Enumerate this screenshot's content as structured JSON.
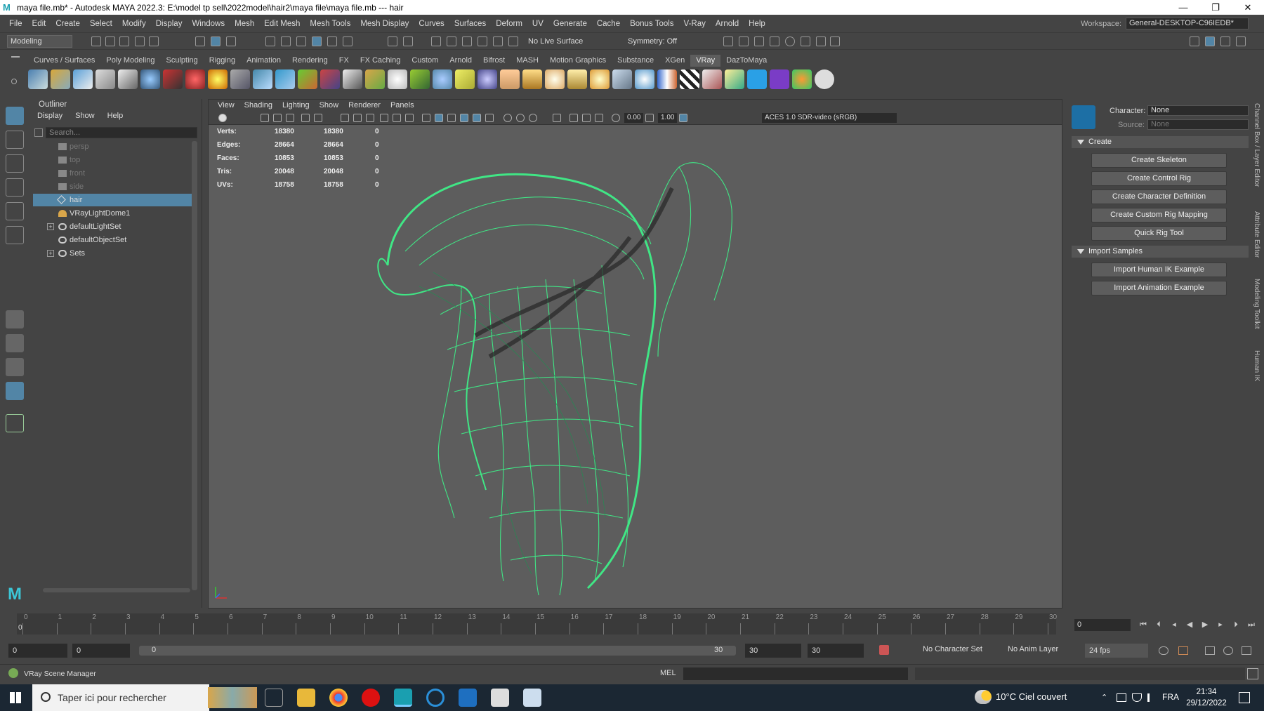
{
  "window": {
    "title": "maya file.mb* - Autodesk MAYA 2022.3: E:\\model tp sell\\2022model\\hair2\\maya file\\maya file.mb  ---  hair",
    "min": "—",
    "max": "❐",
    "close": "✕"
  },
  "menubar": {
    "items": [
      "File",
      "Edit",
      "Create",
      "Select",
      "Modify",
      "Display",
      "Windows",
      "Mesh",
      "Edit Mesh",
      "Mesh Tools",
      "Mesh Display",
      "Curves",
      "Surfaces",
      "Deform",
      "UV",
      "Generate",
      "Cache",
      "Bonus Tools",
      "V-Ray",
      "Arnold",
      "Help"
    ],
    "workspace_label": "Workspace:",
    "workspace_value": "General-DESKTOP-C96IEDB*"
  },
  "statusline": {
    "mode": "Modeling",
    "live_surface": "No Live Surface",
    "symmetry": "Symmetry: Off"
  },
  "shelf": {
    "tabs": [
      "Curves / Surfaces",
      "Poly Modeling",
      "Sculpting",
      "Rigging",
      "Animation",
      "Rendering",
      "FX",
      "FX Caching",
      "Custom",
      "Arnold",
      "Bifrost",
      "MASH",
      "Motion Graphics",
      "Substance",
      "XGen",
      "VRay",
      "DazToMaya"
    ],
    "active": "VRay"
  },
  "outliner": {
    "title": "Outliner",
    "menu": [
      "Display",
      "Show",
      "Help"
    ],
    "search_placeholder": "Search...",
    "items": [
      {
        "label": "persp"
      },
      {
        "label": "top"
      },
      {
        "label": "front"
      },
      {
        "label": "side"
      },
      {
        "label": "hair"
      },
      {
        "label": "VRayLightDome1"
      },
      {
        "label": "defaultLightSet"
      },
      {
        "label": "defaultObjectSet"
      },
      {
        "label": "Sets"
      }
    ]
  },
  "viewport": {
    "menu": [
      "View",
      "Shading",
      "Lighting",
      "Show",
      "Renderer",
      "Panels"
    ],
    "exposure": "0.00",
    "gamma": "1.00",
    "color_space": "ACES 1.0 SDR-video (sRGB)",
    "hud": [
      {
        "label": "Verts:",
        "a": "18380",
        "b": "18380",
        "c": "0"
      },
      {
        "label": "Edges:",
        "a": "28664",
        "b": "28664",
        "c": "0"
      },
      {
        "label": "Faces:",
        "a": "10853",
        "b": "10853",
        "c": "0"
      },
      {
        "label": "Tris:",
        "a": "20048",
        "b": "20048",
        "c": "0"
      },
      {
        "label": "UVs:",
        "a": "18758",
        "b": "18758",
        "c": "0"
      }
    ],
    "wire_color": "#3df58a"
  },
  "humanik": {
    "character_label": "Character:",
    "character_value": "None",
    "source_label": "Source:",
    "source_value": "None",
    "create_header": "Create",
    "create_buttons": [
      "Create Skeleton",
      "Create Control Rig",
      "Create Character Definition",
      "Create Custom Rig Mapping",
      "Quick Rig Tool"
    ],
    "import_header": "Import Samples",
    "import_buttons": [
      "Import Human IK Example",
      "Import Animation Example"
    ]
  },
  "sidetabs": [
    "Channel Box / Layer Editor",
    "Attribute Editor",
    "Modeling Toolkit",
    "Human IK"
  ],
  "timeline": {
    "ticks": [
      "0",
      "1",
      "2",
      "3",
      "4",
      "5",
      "6",
      "7",
      "8",
      "9",
      "10",
      "11",
      "12",
      "13",
      "14",
      "15",
      "16",
      "17",
      "18",
      "19",
      "20",
      "21",
      "22",
      "23",
      "24",
      "25",
      "26",
      "27",
      "28",
      "29",
      "30"
    ],
    "current_frame": "0",
    "playhead": "0"
  },
  "range": {
    "start": "0",
    "playback_start": "0",
    "range_start": "0",
    "range_end": "30",
    "playback_end": "30",
    "end": "30",
    "character_set": "No Character Set",
    "anim_layer": "No Anim Layer",
    "fps": "24 fps"
  },
  "cmdline": {
    "status": "VRay Scene Manager",
    "mel": "MEL"
  },
  "taskbar": {
    "search": "Taper ici pour rechercher",
    "weather": "10°C  Ciel couvert",
    "lang": "FRA",
    "time": "21:34",
    "date": "29/12/2022"
  }
}
